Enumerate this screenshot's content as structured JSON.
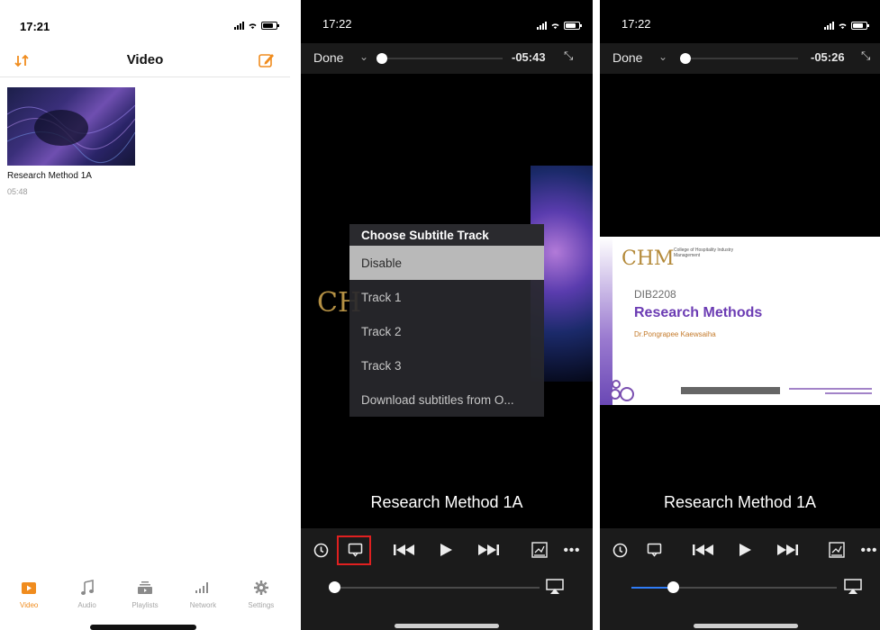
{
  "library": {
    "status_time": "17:21",
    "nav_title": "Video",
    "video": {
      "title": "Research Method 1A",
      "duration": "05:48"
    },
    "tabs": [
      {
        "label": "Video",
        "icon": "video-icon",
        "active": true
      },
      {
        "label": "Audio",
        "icon": "music-note-icon",
        "active": false
      },
      {
        "label": "Playlists",
        "icon": "playlists-icon",
        "active": false
      },
      {
        "label": "Network",
        "icon": "network-bars-icon",
        "active": false
      },
      {
        "label": "Settings",
        "icon": "gear-icon",
        "active": false
      }
    ]
  },
  "player_menu": {
    "status_time": "17:22",
    "done_label": "Done",
    "remaining": "-05:43",
    "progress": 0.0,
    "menu_title": "Choose Subtitle Track",
    "menu_items": [
      "Disable",
      "Track 1",
      "Track 2",
      "Track 3",
      "Download subtitles from O..."
    ],
    "selected_item": "Disable",
    "subtitle_text": "Research Method 1A",
    "volume": 0.0
  },
  "player_slide": {
    "status_time": "17:22",
    "done_label": "Done",
    "remaining": "-05:26",
    "progress": 0.04,
    "subtitle_text": "Research Method 1A",
    "volume": 0.2,
    "slide": {
      "logo": "CHM",
      "college": "College of Hospitality Industry Management",
      "code": "DIB2208",
      "course": "Research Methods",
      "lecturer": "Dr.Pongrapee Kaewsaiha"
    }
  },
  "colors": {
    "accent_orange": "#f08c1e",
    "slider_blue": "#2f7cf6",
    "highlight_red": "#e02020",
    "course_purple": "#6b3bb3"
  }
}
